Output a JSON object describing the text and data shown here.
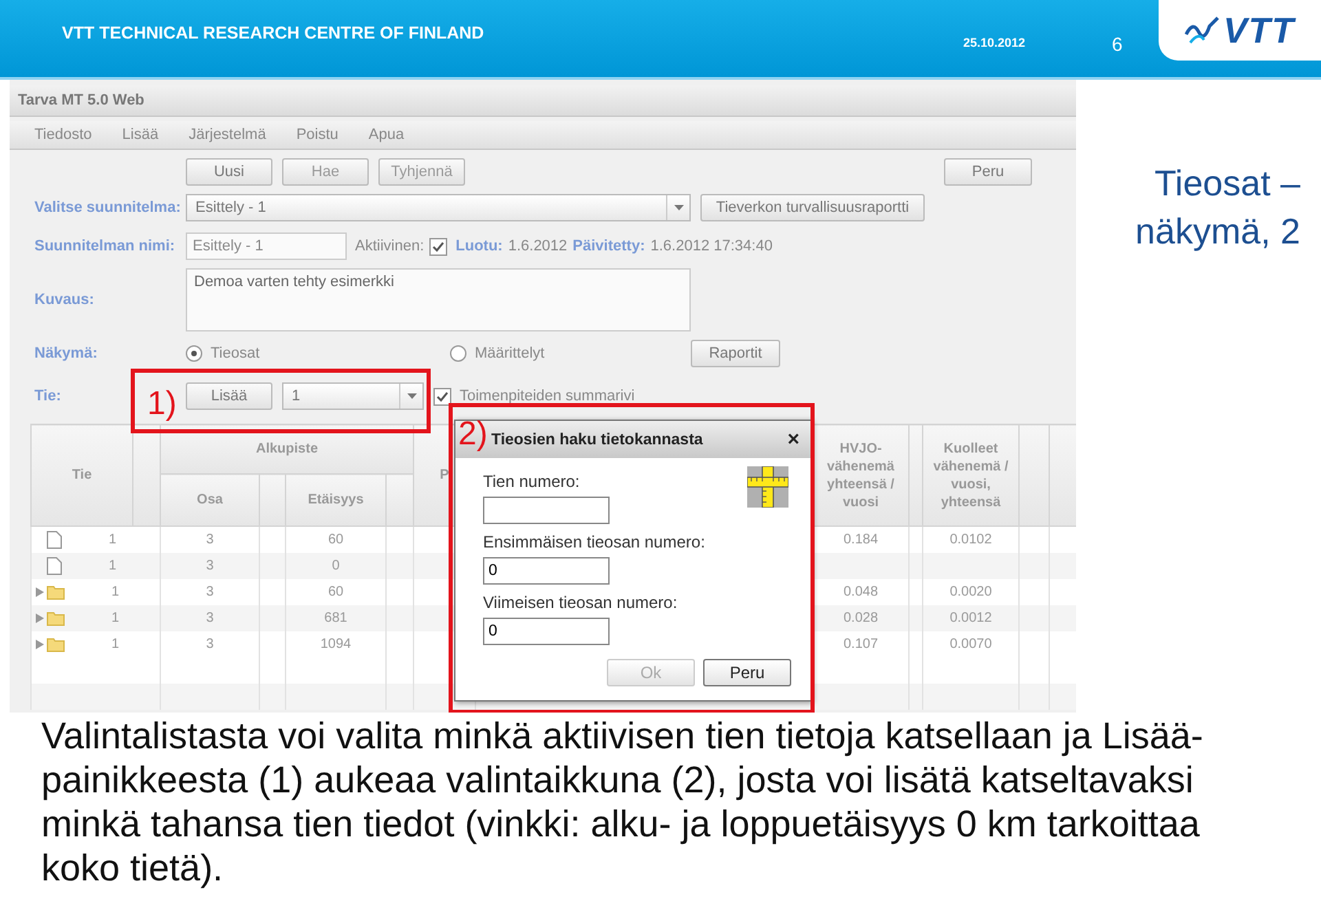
{
  "slide_header": {
    "organization": "VTT TECHNICAL RESEARCH CENTRE OF FINLAND",
    "date": "25.10.2012",
    "page_number": "6",
    "logo_text": "VTT"
  },
  "app": {
    "title": "Tarva MT 5.0 Web",
    "menu": [
      "Tiedosto",
      "Lisää",
      "Järjestelmä",
      "Poistu",
      "Apua"
    ],
    "top_buttons": [
      {
        "label": "Uusi",
        "disabled": false
      },
      {
        "label": "Hae",
        "disabled": true
      },
      {
        "label": "Tyhjennä",
        "disabled": true
      }
    ],
    "cancel_button": "Peru",
    "plan_select": {
      "label": "Valitse suunnitelma:",
      "value": "Esittely - 1"
    },
    "report_button": "Tieverkon turvallisuusraportti",
    "plan_name": {
      "label": "Suunnitelman nimi:",
      "value": "Esittely - 1",
      "disabled": true
    },
    "active": {
      "label": "Aktiivinen:",
      "checked": true
    },
    "created": {
      "label": "Luotu:",
      "value": "1.6.2012"
    },
    "updated": {
      "label": "Päivitetty:",
      "value": "1.6.2012 17:34:40"
    },
    "description": {
      "label": "Kuvaus:",
      "value": "Demoa varten tehty esimerkki"
    },
    "view": {
      "label": "Näkymä:",
      "options": [
        {
          "label": "Tieosat",
          "selected": true
        },
        {
          "label": "Määrittelyt",
          "selected": false
        }
      ]
    },
    "reports_button": "Raportit",
    "road": {
      "label": "Tie:",
      "add_button": "Lisää",
      "select_value": "1",
      "summary": {
        "label": "Toimenpiteiden summarivi",
        "checked": true
      }
    },
    "table": {
      "tie_header": "Tie",
      "group_header": "Alkupiste",
      "group_columns": [
        "Osa",
        "Etäisyys"
      ],
      "column_4": "P",
      "hvjo_header": "HVJO-vähenemä yhteensä / vuosi",
      "deaths_header": "Kuolleet vähenemä / vuosi, yhteensä",
      "rows": [
        {
          "kind": "file",
          "tie": "1",
          "osa": "3",
          "etaisyys": "60",
          "hvjo": "0.184",
          "deaths": "0.0102"
        },
        {
          "kind": "file",
          "tie": "1",
          "osa": "3",
          "etaisyys": "0"
        },
        {
          "kind": "folder",
          "tie": "1",
          "osa": "3",
          "etaisyys": "60",
          "hvjo": "0.048",
          "deaths": "0.0020"
        },
        {
          "kind": "folder",
          "tie": "1",
          "osa": "3",
          "etaisyys": "681",
          "hvjo": "0.028",
          "deaths": "0.0012"
        },
        {
          "kind": "folder",
          "tie": "1",
          "osa": "3",
          "etaisyys": "1094",
          "hvjo": "0.107",
          "deaths": "0.0070"
        }
      ]
    },
    "dialog": {
      "title": "Tieosien haku tietokannasta",
      "close": "×",
      "fields": [
        {
          "label": "Tien numero:"
        },
        {
          "label": "Ensimmäisen tieosan numero:",
          "value": "0"
        },
        {
          "label": "Viimeisen tieosan numero:",
          "value": "0"
        }
      ],
      "ok_button": {
        "label": "Ok",
        "disabled": true
      },
      "cancel_button": "Peru"
    }
  },
  "annotations": [
    {
      "label": "1)"
    },
    {
      "label": "2)"
    }
  ],
  "slide_title": "Tieosat – näkymä, 2",
  "caption": "Valintalistasta voi valita minkä aktiivisen tien tietoja katsellaan ja Lisää-painikkeesta (1) aukeaa valintaikkuna (2), josta voi lisätä katseltavaksi minkä tahansa tien tiedot (vinkki: alku- ja loppuetäisyys 0 km tarkoittaa koko tietä)."
}
